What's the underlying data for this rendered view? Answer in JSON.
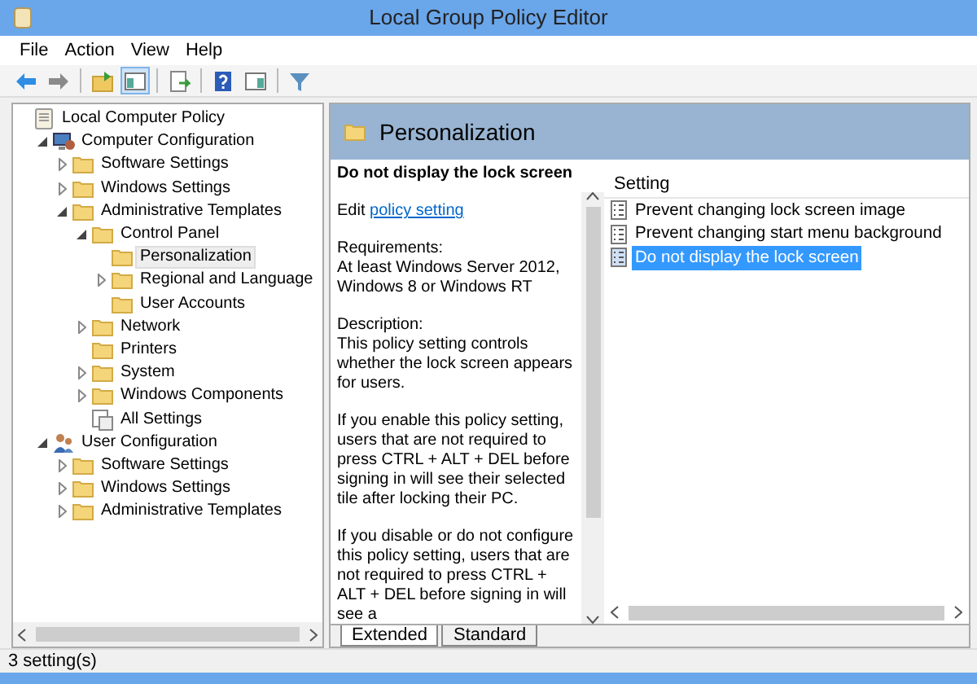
{
  "window": {
    "title": "Local Group Policy Editor"
  },
  "menu": [
    "File",
    "Action",
    "View",
    "Help"
  ],
  "toolbar": [
    {
      "kind": "back"
    },
    {
      "kind": "forward"
    },
    {
      "kind": "sep"
    },
    {
      "kind": "up",
      "selected": false
    },
    {
      "kind": "pane",
      "selected": true
    },
    {
      "kind": "sep"
    },
    {
      "kind": "export",
      "selected": false
    },
    {
      "kind": "sep"
    },
    {
      "kind": "help",
      "selected": false
    },
    {
      "kind": "pane2",
      "selected": false
    },
    {
      "kind": "sep"
    },
    {
      "kind": "filter",
      "selected": false
    }
  ],
  "tree": [
    {
      "label": "Local Computer Policy",
      "kind": "policy",
      "selected": false,
      "children": [
        {
          "label": "Computer Configuration",
          "kind": "computer",
          "expanded": true,
          "selected": false,
          "children": [
            {
              "label": "Software Settings",
              "kind": "folder",
              "expanded": false,
              "selected": false
            },
            {
              "label": "Windows Settings",
              "kind": "folder",
              "expanded": false,
              "selected": false
            },
            {
              "label": "Administrative Templates",
              "kind": "folder",
              "expanded": true,
              "selected": false,
              "children": [
                {
                  "label": "Control Panel",
                  "kind": "folder",
                  "expanded": true,
                  "selected": false,
                  "children": [
                    {
                      "label": "Personalization",
                      "kind": "folder",
                      "selected": true
                    },
                    {
                      "label": "Regional and Language",
                      "kind": "folder",
                      "expanded": false,
                      "selected": false
                    },
                    {
                      "label": "User Accounts",
                      "kind": "folder",
                      "selected": false
                    }
                  ]
                },
                {
                  "label": "Network",
                  "kind": "folder",
                  "expanded": false,
                  "selected": false
                },
                {
                  "label": "Printers",
                  "kind": "folder",
                  "selected": false
                },
                {
                  "label": "System",
                  "kind": "folder",
                  "expanded": false,
                  "selected": false
                },
                {
                  "label": "Windows Components",
                  "kind": "folder",
                  "expanded": false,
                  "selected": false
                },
                {
                  "label": "All Settings",
                  "kind": "settings",
                  "selected": false
                }
              ]
            }
          ]
        },
        {
          "label": "User Configuration",
          "kind": "user",
          "expanded": true,
          "selected": false,
          "children": [
            {
              "label": "Software Settings",
              "kind": "folder",
              "expanded": false,
              "selected": false
            },
            {
              "label": "Windows Settings",
              "kind": "folder",
              "expanded": false,
              "selected": false
            },
            {
              "label": "Administrative Templates",
              "kind": "folder",
              "expanded": false,
              "selected": false
            }
          ]
        }
      ]
    }
  ],
  "details": {
    "header": "Personalization",
    "title": "Do not display the lock screen",
    "edit_prefix": "Edit",
    "edit_link": "policy setting",
    "paragraphs": [
      "Requirements:\nAt least Windows Server 2012, Windows 8 or Windows RT",
      "Description:\nThis policy setting controls whether the lock screen appears for users.",
      "If you enable this policy setting, users that are not required to press CTRL + ALT + DEL before signing in will see their selected tile after locking their PC.",
      "If you disable or do not configure this policy setting, users that are not required to press CTRL + ALT + DEL before signing in will see a"
    ]
  },
  "settings": {
    "column": "Setting",
    "rows": [
      {
        "label": "Prevent changing lock screen image",
        "selected": false
      },
      {
        "label": "Prevent changing start menu background",
        "selected": false
      },
      {
        "label": "Do not display the lock screen",
        "selected": true
      }
    ]
  },
  "view_tabs": [
    {
      "label": "Extended",
      "selected": true
    },
    {
      "label": "Standard",
      "selected": false
    }
  ],
  "status_bar": "3 setting(s)"
}
